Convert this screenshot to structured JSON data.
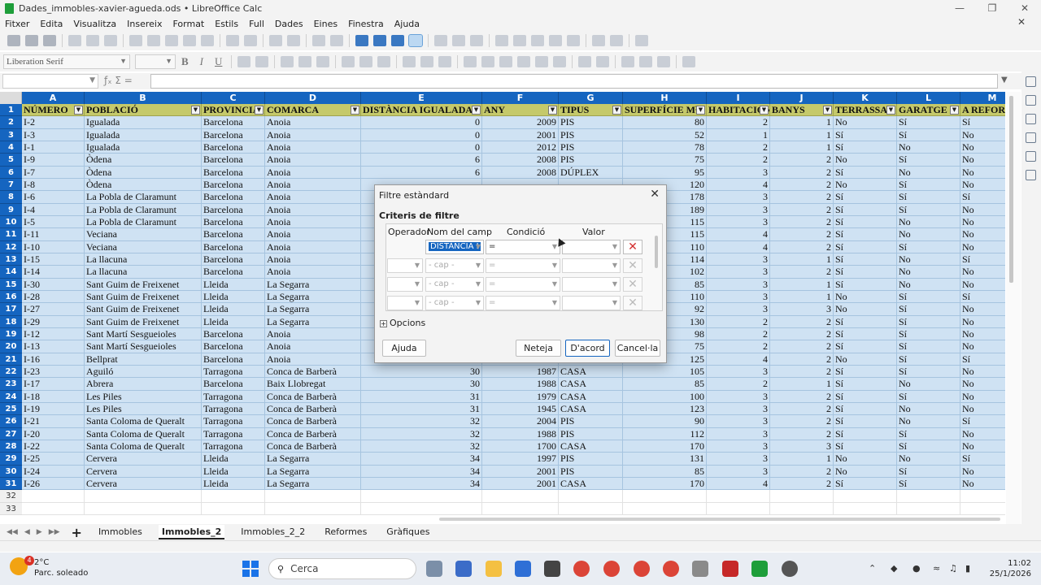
{
  "window": {
    "title": "Dades_immobles-xavier-agueda.ods • LibreOffice Calc"
  },
  "menu": [
    "Fitxer",
    "Edita",
    "Visualitza",
    "Insereix",
    "Format",
    "Estils",
    "Full",
    "Dades",
    "Eines",
    "Finestra",
    "Ajuda"
  ],
  "toolbar2": {
    "font_name": "Liberation Serif",
    "font_size": ""
  },
  "formula_bar": {
    "cell_ref": "",
    "content": ""
  },
  "columns": [
    "A",
    "B",
    "C",
    "D",
    "E",
    "F",
    "G",
    "H",
    "I",
    "J",
    "K",
    "L",
    "M"
  ],
  "header_row": [
    "NÚMERO",
    "POBLACIÓ",
    "PROVINCIA",
    "COMARCA",
    "DISTÀNCIA IGUALADA",
    "ANY",
    "TIPUS",
    "SUPERFÍCIE M²",
    "HABITACIONS",
    "BANYS",
    "TERRASSA",
    "GARATGE",
    "A REFORMAR"
  ],
  "rows": [
    [
      "I-2",
      "Igualada",
      "Barcelona",
      "Anoia",
      "0",
      "2009",
      "PIS",
      "80",
      "2",
      "1",
      "No",
      "Sí",
      "Sí"
    ],
    [
      "I-3",
      "Igualada",
      "Barcelona",
      "Anoia",
      "0",
      "2001",
      "PIS",
      "52",
      "1",
      "1",
      "Sí",
      "Sí",
      "No"
    ],
    [
      "I-1",
      "Igualada",
      "Barcelona",
      "Anoia",
      "0",
      "2012",
      "PIS",
      "78",
      "2",
      "1",
      "Sí",
      "No",
      "No"
    ],
    [
      "I-9",
      "Òdena",
      "Barcelona",
      "Anoia",
      "6",
      "2008",
      "PIS",
      "75",
      "2",
      "2",
      "No",
      "Sí",
      "No"
    ],
    [
      "I-7",
      "Òdena",
      "Barcelona",
      "Anoia",
      "6",
      "2008",
      "DÚPLEX",
      "95",
      "3",
      "2",
      "Sí",
      "No",
      "No"
    ],
    [
      "I-8",
      "Òdena",
      "Barcelona",
      "Anoia",
      "",
      "",
      "",
      "120",
      "4",
      "2",
      "No",
      "Sí",
      "No"
    ],
    [
      "I-6",
      "La Pobla de Claramunt",
      "Barcelona",
      "Anoia",
      "",
      "",
      "",
      "178",
      "3",
      "2",
      "Sí",
      "Sí",
      "Sí"
    ],
    [
      "I-4",
      "La Pobla de Claramunt",
      "Barcelona",
      "Anoia",
      "",
      "",
      "",
      "189",
      "3",
      "2",
      "Sí",
      "Sí",
      "No"
    ],
    [
      "I-5",
      "La Pobla de Claramunt",
      "Barcelona",
      "Anoia",
      "",
      "",
      "",
      "115",
      "3",
      "2",
      "Sí",
      "No",
      "No"
    ],
    [
      "I-11",
      "Veciana",
      "Barcelona",
      "Anoia",
      "",
      "",
      "",
      "115",
      "4",
      "2",
      "Sí",
      "No",
      "No"
    ],
    [
      "I-10",
      "Veciana",
      "Barcelona",
      "Anoia",
      "",
      "",
      "",
      "110",
      "4",
      "2",
      "Sí",
      "Sí",
      "No"
    ],
    [
      "I-15",
      "La llacuna",
      "Barcelona",
      "Anoia",
      "",
      "",
      "",
      "114",
      "3",
      "1",
      "Sí",
      "No",
      "Sí"
    ],
    [
      "I-14",
      "La llacuna",
      "Barcelona",
      "Anoia",
      "",
      "",
      "",
      "102",
      "3",
      "2",
      "Sí",
      "No",
      "No"
    ],
    [
      "I-30",
      "Sant Guim de Freixenet",
      "Lleida",
      "La Segarra",
      "",
      "",
      "",
      "85",
      "3",
      "1",
      "Sí",
      "No",
      "No"
    ],
    [
      "I-28",
      "Sant Guim de Freixenet",
      "Lleida",
      "La Segarra",
      "",
      "",
      "",
      "110",
      "3",
      "1",
      "No",
      "Sí",
      "Sí"
    ],
    [
      "I-27",
      "Sant Guim de Freixenet",
      "Lleida",
      "La Segarra",
      "",
      "",
      "",
      "92",
      "3",
      "3",
      "No",
      "Sí",
      "No"
    ],
    [
      "I-29",
      "Sant Guim de Freixenet",
      "Lleida",
      "La Segarra",
      "",
      "",
      "",
      "130",
      "2",
      "2",
      "Sí",
      "Sí",
      "No"
    ],
    [
      "I-12",
      "Sant Martí Sesgueioles",
      "Barcelona",
      "Anoia",
      "",
      "",
      "",
      "98",
      "2",
      "2",
      "Sí",
      "Sí",
      "No"
    ],
    [
      "I-13",
      "Sant Martí Sesgueioles",
      "Barcelona",
      "Anoia",
      "",
      "",
      "",
      "75",
      "2",
      "2",
      "Sí",
      "Sí",
      "No"
    ],
    [
      "I-16",
      "Bellprat",
      "Barcelona",
      "Anoia",
      "",
      "",
      "",
      "125",
      "4",
      "2",
      "No",
      "Sí",
      "Sí"
    ],
    [
      "I-23",
      "Aguiló",
      "Tarragona",
      "Conca de Barberà",
      "30",
      "1987",
      "CASA",
      "105",
      "3",
      "2",
      "Sí",
      "Sí",
      "No"
    ],
    [
      "I-17",
      "Abrera",
      "Barcelona",
      "Baix Llobregat",
      "30",
      "1988",
      "CASA",
      "85",
      "2",
      "1",
      "Sí",
      "No",
      "No"
    ],
    [
      "I-18",
      "Les Piles",
      "Tarragona",
      "Conca de Barberà",
      "31",
      "1979",
      "CASA",
      "100",
      "3",
      "2",
      "Sí",
      "Sí",
      "No"
    ],
    [
      "I-19",
      "Les Piles",
      "Tarragona",
      "Conca de Barberà",
      "31",
      "1945",
      "CASA",
      "123",
      "3",
      "2",
      "Sí",
      "No",
      "No"
    ],
    [
      "I-21",
      "Santa Coloma de Queralt",
      "Tarragona",
      "Conca de Barberà",
      "32",
      "2004",
      "PIS",
      "90",
      "3",
      "2",
      "Sí",
      "No",
      "Sí"
    ],
    [
      "I-20",
      "Santa Coloma de Queralt",
      "Tarragona",
      "Conca de Barberà",
      "32",
      "1988",
      "PIS",
      "112",
      "3",
      "2",
      "Sí",
      "Sí",
      "No"
    ],
    [
      "I-22",
      "Santa Coloma de Queralt",
      "Tarragona",
      "Conca de Barberà",
      "32",
      "1700",
      "CASA",
      "170",
      "3",
      "3",
      "Sí",
      "Sí",
      "No"
    ],
    [
      "I-25",
      "Cervera",
      "Lleida",
      "La Segarra",
      "34",
      "1997",
      "PIS",
      "131",
      "3",
      "1",
      "No",
      "No",
      "Sí"
    ],
    [
      "I-24",
      "Cervera",
      "Lleida",
      "La Segarra",
      "34",
      "2001",
      "PIS",
      "85",
      "3",
      "2",
      "No",
      "Sí",
      "No"
    ],
    [
      "I-26",
      "Cervera",
      "Lleida",
      "La Segarra",
      "34",
      "2001",
      "CASA",
      "170",
      "4",
      "2",
      "Sí",
      "Sí",
      "No"
    ]
  ],
  "sheet_tabs": [
    "Immobles",
    "Immobles_2",
    "Immobles_2_2",
    "Reformes",
    "Gràfiques"
  ],
  "active_sheet": "Immobles_2",
  "dialog": {
    "title": "Filtre estàndard",
    "section": "Criteris de filtre",
    "headers": {
      "operator": "Operador",
      "field": "Nom del camp",
      "condition": "Condició",
      "value": "Valor"
    },
    "criteria": [
      {
        "operator": "",
        "field": "DISTÀNCIA I",
        "condition": "=",
        "value": ""
      },
      {
        "operator": "",
        "field": "- cap -",
        "condition": "=",
        "value": ""
      },
      {
        "operator": "",
        "field": "- cap -",
        "condition": "=",
        "value": ""
      },
      {
        "operator": "",
        "field": "- cap -",
        "condition": "=",
        "value": ""
      }
    ],
    "options_label": "Opcions",
    "buttons": {
      "help": "Ajuda",
      "reset": "Neteja",
      "ok": "D'acord",
      "cancel": "Cancel·la"
    }
  },
  "taskbar": {
    "weather_temp": "2°C",
    "weather_desc": "Parc. soleado",
    "weather_badge": "4",
    "search_placeholder": "Cerca",
    "time": "11:02",
    "date": "25/1/2026"
  },
  "colors": {
    "header_blue": "#1565c0",
    "selection": "#cfe2f3",
    "header_row": "#c5c96a"
  }
}
